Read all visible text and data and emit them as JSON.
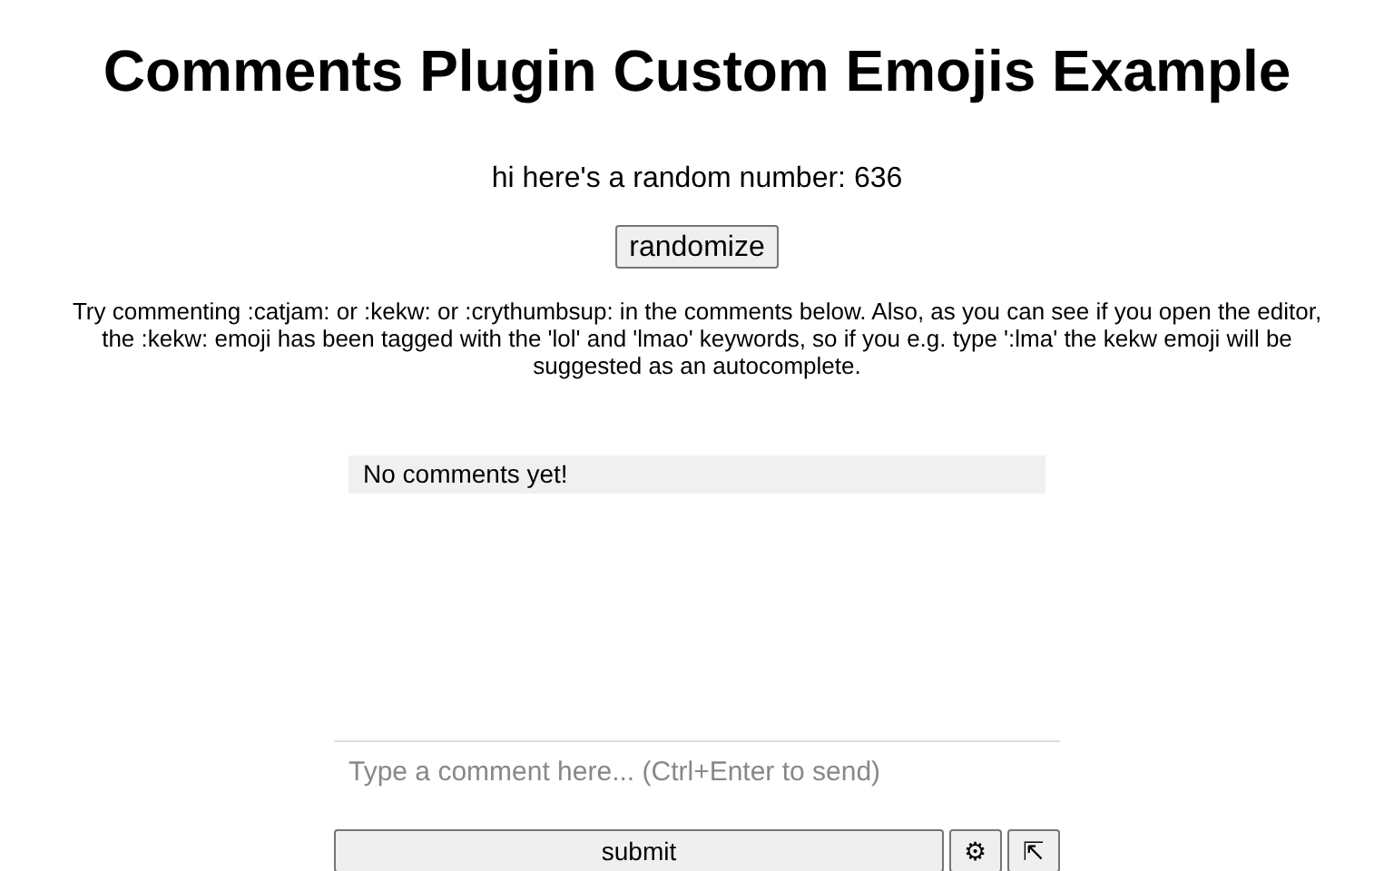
{
  "title": "Comments Plugin Custom Emojis Example",
  "random_text": "hi here's a random number: 636",
  "randomize_button": "randomize",
  "description": "Try commenting :catjam: or :kekw: or :crythumbsup: in the comments below. Also, as you can see if you open the editor, the :kekw: emoji has been tagged with the 'lol' and 'lmao' keywords, so if you e.g. type ':lma' the kekw emoji will be suggested as an autocomplete.",
  "comments": {
    "empty_text": "No comments yet!"
  },
  "composer": {
    "placeholder": "Type a comment here... (Ctrl+Enter to send)",
    "submit": "submit",
    "settings_button": "⚙",
    "expand_button": "⇱"
  }
}
